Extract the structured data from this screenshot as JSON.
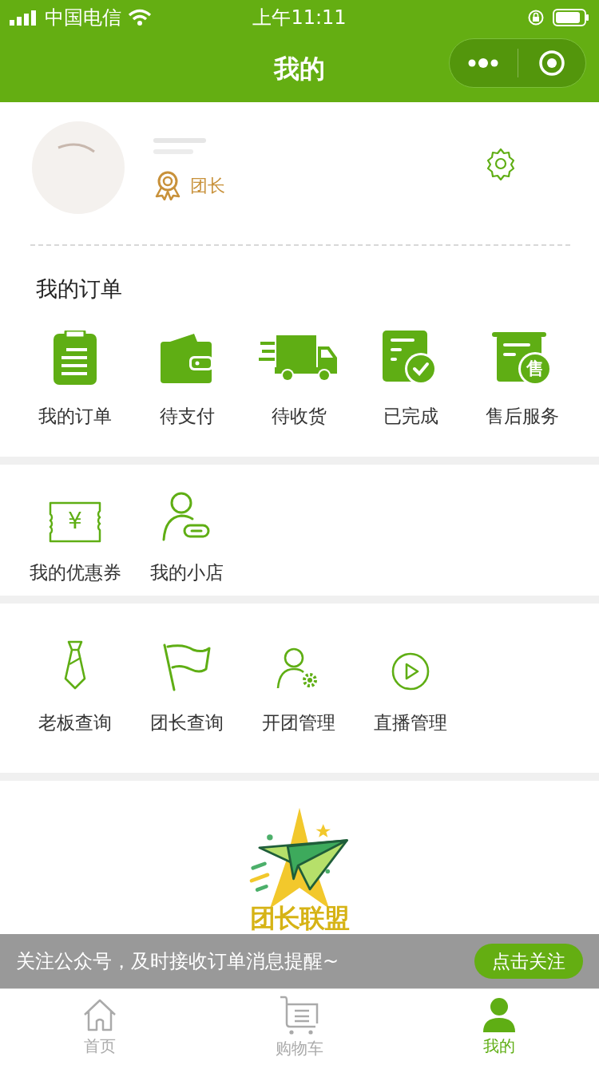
{
  "status_bar": {
    "carrier": "中国电信",
    "time": "上午11:11"
  },
  "nav": {
    "title": "我的"
  },
  "profile": {
    "role": "团长"
  },
  "orders": {
    "title": "我的订单",
    "items": [
      {
        "label": "我的订单",
        "kind": "clipboard"
      },
      {
        "label": "待支付",
        "kind": "wallet"
      },
      {
        "label": "待收货",
        "kind": "truck"
      },
      {
        "label": "已完成",
        "kind": "done"
      },
      {
        "label": "售后服务",
        "kind": "service",
        "glyph": "售"
      }
    ]
  },
  "tools": [
    {
      "label": "我的优惠券",
      "kind": "coupon",
      "glyph": "¥"
    },
    {
      "label": "我的小店",
      "kind": "shop"
    }
  ],
  "admin": [
    {
      "label": "老板查询",
      "kind": "tie"
    },
    {
      "label": "团长查询",
      "kind": "flag"
    },
    {
      "label": "开团管理",
      "kind": "usergear"
    },
    {
      "label": "直播管理",
      "kind": "play"
    }
  ],
  "logo": {
    "text": "团长联盟"
  },
  "follow_banner": {
    "message": "关注公众号，及时接收订单消息提醒~",
    "button": "点击关注"
  },
  "tab_bar": [
    {
      "label": "首页",
      "kind": "home",
      "selected": false
    },
    {
      "label": "购物车",
      "kind": "cart",
      "selected": false
    },
    {
      "label": "我的",
      "kind": "user",
      "selected": true
    }
  ]
}
